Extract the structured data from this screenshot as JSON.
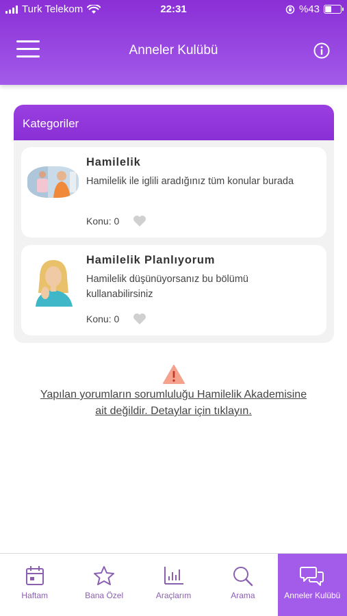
{
  "status_bar": {
    "carrier": "Turk Telekom",
    "time": "22:31",
    "battery": "%43",
    "battery_level": 0.43
  },
  "header": {
    "title": "Anneler Kulübü"
  },
  "categories": {
    "heading": "Kategoriler",
    "items": [
      {
        "title": "Hamilelik",
        "description": "Hamilelik ile iglili aradığınız tüm konular burada",
        "count_label": "Konu: 0"
      },
      {
        "title": "Hamilelik Planlıyorum",
        "description": "Hamilelik düşünüyorsanız bu bölümü kullanabilirsiniz",
        "count_label": "Konu: 0"
      }
    ]
  },
  "disclaimer": {
    "line1": "Yapılan yorumların sorumluluğu Hamilelik Akademisine",
    "line2": "ait değildir. Detaylar için tıklayın."
  },
  "tabs": [
    {
      "label": "Haftam",
      "icon": "calendar-icon"
    },
    {
      "label": "Bana Özel",
      "icon": "star-icon"
    },
    {
      "label": "Araçlarım",
      "icon": "bar-chart-icon"
    },
    {
      "label": "Arama",
      "icon": "search-icon"
    },
    {
      "label": "Anneler Kulübü",
      "icon": "chat-icon",
      "active": true
    }
  ],
  "colors": {
    "primary": "#8a2fd6",
    "accent": "#a35bea",
    "tab_icon": "#8a5fb0",
    "warning": "#f4a28c"
  }
}
